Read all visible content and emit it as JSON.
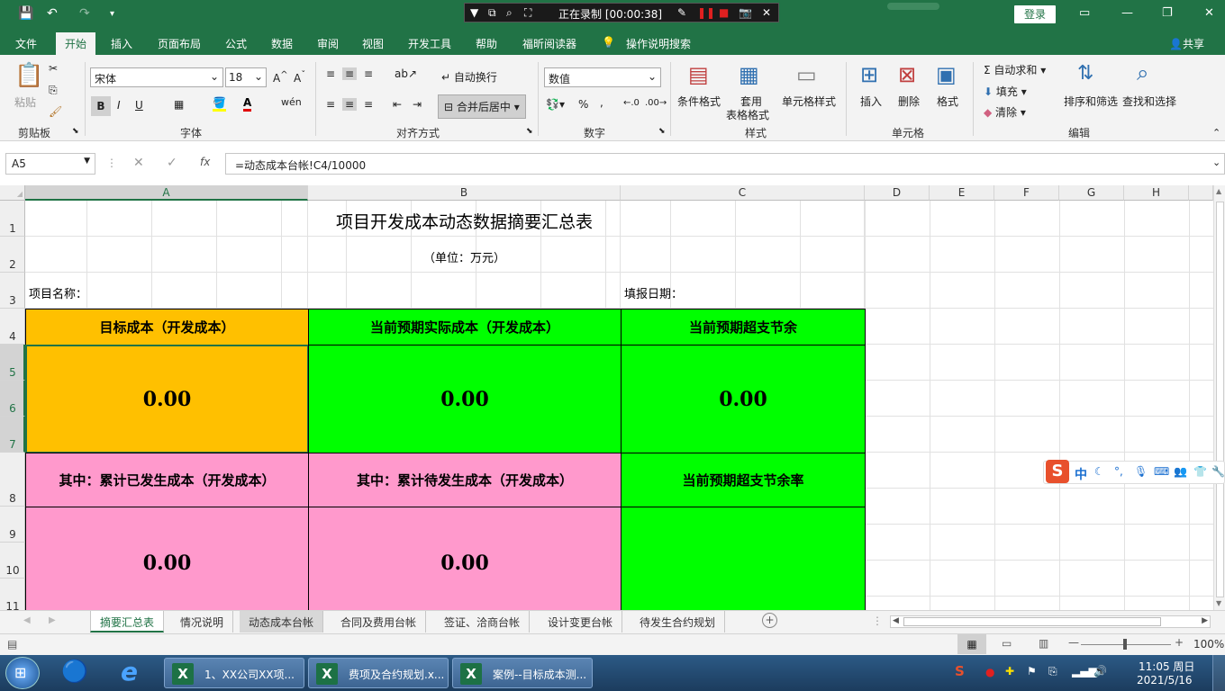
{
  "titlebar": {
    "recording": "正在录制 [00:00:38]",
    "login": "登录"
  },
  "ribbon_tabs": [
    "文件",
    "开始",
    "插入",
    "页面布局",
    "公式",
    "数据",
    "审阅",
    "视图",
    "开发工具",
    "帮助",
    "福昕阅读器",
    "操作说明搜索",
    "共享"
  ],
  "ribbon": {
    "clipboard": {
      "paste": "粘贴",
      "label": "剪贴板"
    },
    "font": {
      "name": "宋体",
      "size": "18",
      "bold": "B",
      "italic": "I",
      "underline": "U",
      "label": "字体"
    },
    "align": {
      "wrap": "自动换行",
      "merge": "合并后居中",
      "label": "对齐方式"
    },
    "number": {
      "format": "数值",
      "label": "数字"
    },
    "styles": {
      "cond": "条件格式",
      "table": "套用",
      "table2": "表格格式",
      "cell": "单元格样式",
      "label": "样式"
    },
    "cells": {
      "insert": "插入",
      "delete": "删除",
      "format": "格式",
      "label": "单元格"
    },
    "edit": {
      "autosum": "自动求和",
      "fill": "填充",
      "clear": "清除",
      "sort": "排序和筛选",
      "find": "查找和选择",
      "label": "编辑"
    }
  },
  "formula": {
    "namebox": "A5",
    "fx": "fx",
    "content": "=动态成本台帐!C4/10000"
  },
  "columns": [
    "A",
    "B",
    "C",
    "D",
    "E",
    "F",
    "G",
    "H"
  ],
  "rows": [
    "1",
    "2",
    "3",
    "4",
    "5",
    "6",
    "7",
    "8",
    "9",
    "10",
    "11"
  ],
  "sheet": {
    "title": "项目开发成本动态数据摘要汇总表",
    "unit": "（单位：万元）",
    "project_label": "项目名称：",
    "date_label": "填报日期：",
    "h_target": "目标成本（开发成本）",
    "h_actual": "当前预期实际成本（开发成本）",
    "h_surplus": "当前预期超支节余",
    "v_target": "0.00",
    "v_actual": "0.00",
    "v_surplus": "0.00",
    "h_incurred": "其中：累计已发生成本（开发成本）",
    "h_pending": "其中：累计待发生成本（开发成本）",
    "h_rate": "当前预期超支节余率",
    "v_incurred": "0.00",
    "v_pending": "0.00"
  },
  "sheet_tabs": [
    "摘要汇总表",
    "情况说明",
    "动态成本台帐",
    "合同及费用台帐",
    "签证、洽商台帐",
    "设计变更台帐",
    "待发生合约规划"
  ],
  "status": {
    "zoom": "100%"
  },
  "colors": {
    "orange": "#ffc000",
    "green": "#00ff00",
    "pink": "#ff99cc",
    "excel": "#217346"
  },
  "taskbar": {
    "items": [
      "1、XX公司XX项...",
      "费项及合约规划.x...",
      "案例--目标成本测..."
    ],
    "time": "11:05 周日",
    "date": "2021/5/16"
  },
  "ime": {
    "lang": "中"
  }
}
